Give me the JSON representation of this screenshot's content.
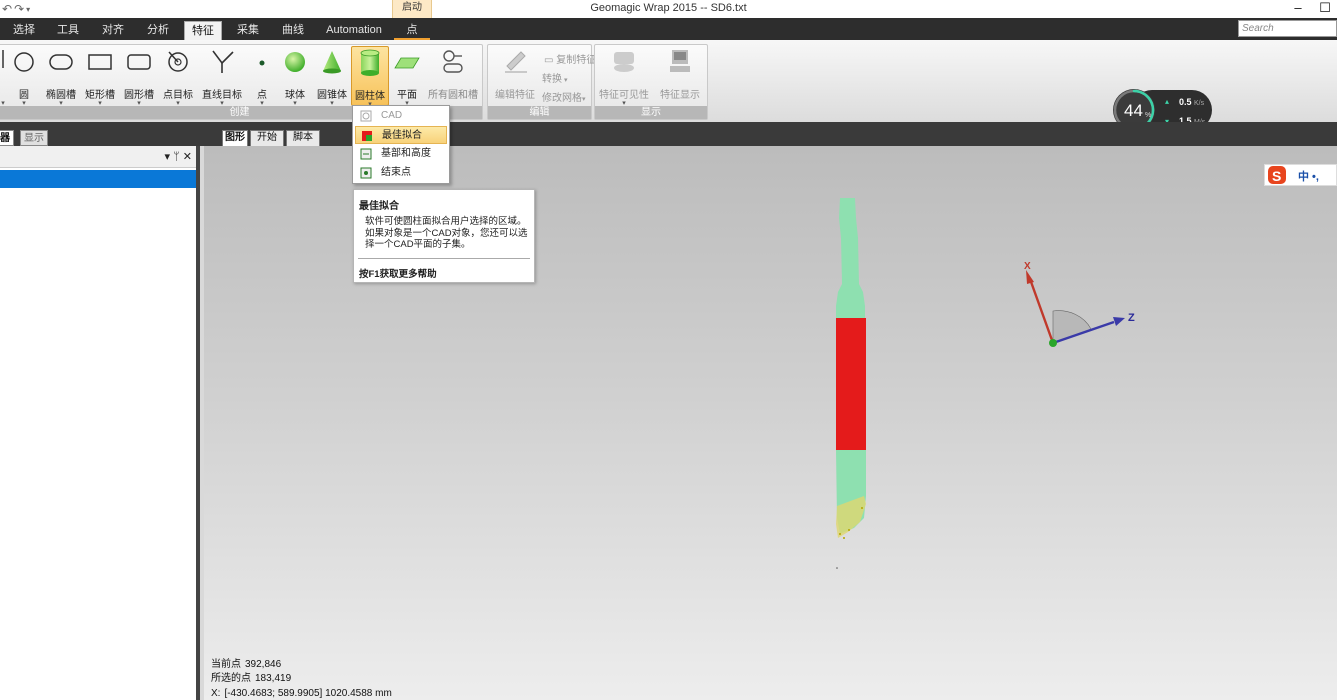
{
  "window": {
    "title": "Geomagic Wrap 2015 -- SD6.txt",
    "context_tab": "启动",
    "minimize": "–",
    "maximize": "☐"
  },
  "tabs": [
    {
      "label": "选择"
    },
    {
      "label": "工具"
    },
    {
      "label": "对齐"
    },
    {
      "label": "分析"
    },
    {
      "label": "特征"
    },
    {
      "label": "采集"
    },
    {
      "label": "曲线"
    },
    {
      "label": "Automation"
    },
    {
      "label": "点"
    }
  ],
  "search": {
    "placeholder": "Search"
  },
  "ribbon": {
    "create_group_label": "创建",
    "create_buttons": [
      {
        "label": "圆",
        "icon": "circle-icon"
      },
      {
        "label": "椭圆槽",
        "icon": "ellipse-slot-icon"
      },
      {
        "label": "矩形槽",
        "icon": "rect-slot-icon"
      },
      {
        "label": "圆形槽",
        "icon": "round-slot-icon"
      },
      {
        "label": "点目标",
        "icon": "point-target-icon"
      },
      {
        "label": "直线目标",
        "icon": "line-target-icon"
      },
      {
        "label": "点",
        "icon": "point-icon"
      },
      {
        "label": "球体",
        "icon": "sphere-icon"
      },
      {
        "label": "圆锥体",
        "icon": "cone-icon"
      },
      {
        "label": "圆柱体",
        "icon": "cylinder-icon"
      },
      {
        "label": "平面",
        "icon": "plane-icon"
      },
      {
        "label": "所有圆和槽",
        "icon": "all-circles-slots-icon"
      }
    ],
    "edit_group_label": "编辑",
    "edit_buttons": {
      "edit_feature": "编辑特征",
      "copy_feature": "复制特征",
      "convert": "转换",
      "modify_mesh": "修改网格"
    },
    "display_group_label": "显示",
    "display_buttons": {
      "visibility": "特征可见性",
      "display": "特征显示"
    }
  },
  "speed_widget": {
    "percent": "44",
    "percent_unit": "%",
    "upload": "0.5",
    "upload_unit": "K/s",
    "download": "1.5",
    "download_unit": "M/s",
    "level": 0.44
  },
  "left_panel": {
    "tab_manager": "器",
    "tab_display": "显示",
    "controls": "▾ ᛘ ✕"
  },
  "viewport_tabs": {
    "graphics": "图形",
    "start": "开始",
    "script": "脚本"
  },
  "dropdown": {
    "items": [
      {
        "label": "CAD",
        "disabled": true
      },
      {
        "label": "最佳拟合",
        "highlighted": true
      },
      {
        "label": "基部和高度"
      },
      {
        "label": "结束点"
      }
    ]
  },
  "tooltip": {
    "title": "最佳拟合",
    "body": "软件可使圆柱面拟合用户选择的区域。如果对象是一个CAD对象，您还可以选择一个CAD平面的子集。",
    "help": "按F1获取更多帮助"
  },
  "triad": {
    "x_label": "X",
    "z_label": "Z"
  },
  "status": {
    "current_points_label": "当前点",
    "current_points_value": "392,846",
    "selected_points_label": "所选的点",
    "selected_points_value": "183,419",
    "coordinates": "[-430.4683; 589.9905] 1020.4588 mm",
    "coord_prefix": "X:"
  },
  "ime": {
    "text": "中 •,"
  },
  "colors": {
    "accent_orange": "#f7c25a",
    "model_green": "#8ee0b0",
    "model_red": "#e41b1b",
    "selection_blue": "#0a78d7"
  }
}
